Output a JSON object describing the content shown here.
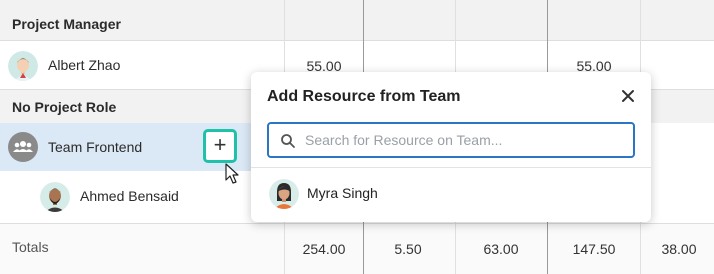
{
  "rows": {
    "project_manager_group": "Project Manager",
    "albert": {
      "name": "Albert Zhao",
      "col1": "55.00",
      "col4": "55.00"
    },
    "no_role_group": "No Project Role",
    "team": {
      "name": "Team Frontend",
      "add_button": "+"
    },
    "ahmed": {
      "name": "Ahmed Bensaid"
    }
  },
  "totals": {
    "label": "Totals",
    "values": [
      "254.00",
      "5.50",
      "63.00",
      "147.50",
      "38.00"
    ]
  },
  "popup": {
    "title": "Add Resource from Team",
    "search_placeholder": "Search for Resource on Team...",
    "search_value": "",
    "results": [
      {
        "name": "Myra Singh"
      }
    ]
  },
  "colors": {
    "accent_teal": "#1fc1a8",
    "focus_blue": "#2a76c2",
    "selected_row": "#dbe8f5"
  }
}
